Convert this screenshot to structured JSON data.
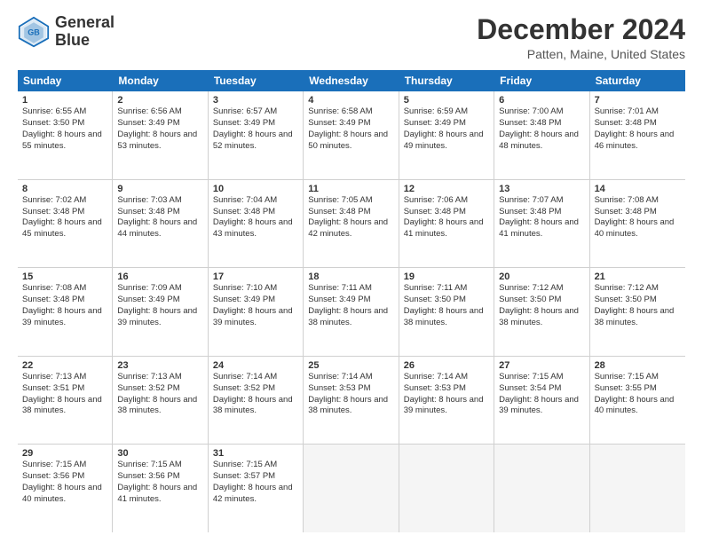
{
  "header": {
    "logo_line1": "General",
    "logo_line2": "Blue",
    "title": "December 2024",
    "subtitle": "Patten, Maine, United States"
  },
  "days": [
    "Sunday",
    "Monday",
    "Tuesday",
    "Wednesday",
    "Thursday",
    "Friday",
    "Saturday"
  ],
  "weeks": [
    [
      {
        "num": "1",
        "rise": "6:55 AM",
        "set": "3:50 PM",
        "daylight": "8 hours and 55 minutes."
      },
      {
        "num": "2",
        "rise": "6:56 AM",
        "set": "3:49 PM",
        "daylight": "8 hours and 53 minutes."
      },
      {
        "num": "3",
        "rise": "6:57 AM",
        "set": "3:49 PM",
        "daylight": "8 hours and 52 minutes."
      },
      {
        "num": "4",
        "rise": "6:58 AM",
        "set": "3:49 PM",
        "daylight": "8 hours and 50 minutes."
      },
      {
        "num": "5",
        "rise": "6:59 AM",
        "set": "3:49 PM",
        "daylight": "8 hours and 49 minutes."
      },
      {
        "num": "6",
        "rise": "7:00 AM",
        "set": "3:48 PM",
        "daylight": "8 hours and 48 minutes."
      },
      {
        "num": "7",
        "rise": "7:01 AM",
        "set": "3:48 PM",
        "daylight": "8 hours and 46 minutes."
      }
    ],
    [
      {
        "num": "8",
        "rise": "7:02 AM",
        "set": "3:48 PM",
        "daylight": "8 hours and 45 minutes."
      },
      {
        "num": "9",
        "rise": "7:03 AM",
        "set": "3:48 PM",
        "daylight": "8 hours and 44 minutes."
      },
      {
        "num": "10",
        "rise": "7:04 AM",
        "set": "3:48 PM",
        "daylight": "8 hours and 43 minutes."
      },
      {
        "num": "11",
        "rise": "7:05 AM",
        "set": "3:48 PM",
        "daylight": "8 hours and 42 minutes."
      },
      {
        "num": "12",
        "rise": "7:06 AM",
        "set": "3:48 PM",
        "daylight": "8 hours and 41 minutes."
      },
      {
        "num": "13",
        "rise": "7:07 AM",
        "set": "3:48 PM",
        "daylight": "8 hours and 41 minutes."
      },
      {
        "num": "14",
        "rise": "7:08 AM",
        "set": "3:48 PM",
        "daylight": "8 hours and 40 minutes."
      }
    ],
    [
      {
        "num": "15",
        "rise": "7:08 AM",
        "set": "3:48 PM",
        "daylight": "8 hours and 39 minutes."
      },
      {
        "num": "16",
        "rise": "7:09 AM",
        "set": "3:49 PM",
        "daylight": "8 hours and 39 minutes."
      },
      {
        "num": "17",
        "rise": "7:10 AM",
        "set": "3:49 PM",
        "daylight": "8 hours and 39 minutes."
      },
      {
        "num": "18",
        "rise": "7:11 AM",
        "set": "3:49 PM",
        "daylight": "8 hours and 38 minutes."
      },
      {
        "num": "19",
        "rise": "7:11 AM",
        "set": "3:50 PM",
        "daylight": "8 hours and 38 minutes."
      },
      {
        "num": "20",
        "rise": "7:12 AM",
        "set": "3:50 PM",
        "daylight": "8 hours and 38 minutes."
      },
      {
        "num": "21",
        "rise": "7:12 AM",
        "set": "3:50 PM",
        "daylight": "8 hours and 38 minutes."
      }
    ],
    [
      {
        "num": "22",
        "rise": "7:13 AM",
        "set": "3:51 PM",
        "daylight": "8 hours and 38 minutes."
      },
      {
        "num": "23",
        "rise": "7:13 AM",
        "set": "3:52 PM",
        "daylight": "8 hours and 38 minutes."
      },
      {
        "num": "24",
        "rise": "7:14 AM",
        "set": "3:52 PM",
        "daylight": "8 hours and 38 minutes."
      },
      {
        "num": "25",
        "rise": "7:14 AM",
        "set": "3:53 PM",
        "daylight": "8 hours and 38 minutes."
      },
      {
        "num": "26",
        "rise": "7:14 AM",
        "set": "3:53 PM",
        "daylight": "8 hours and 39 minutes."
      },
      {
        "num": "27",
        "rise": "7:15 AM",
        "set": "3:54 PM",
        "daylight": "8 hours and 39 minutes."
      },
      {
        "num": "28",
        "rise": "7:15 AM",
        "set": "3:55 PM",
        "daylight": "8 hours and 40 minutes."
      }
    ],
    [
      {
        "num": "29",
        "rise": "7:15 AM",
        "set": "3:56 PM",
        "daylight": "8 hours and 40 minutes."
      },
      {
        "num": "30",
        "rise": "7:15 AM",
        "set": "3:56 PM",
        "daylight": "8 hours and 41 minutes."
      },
      {
        "num": "31",
        "rise": "7:15 AM",
        "set": "3:57 PM",
        "daylight": "8 hours and 42 minutes."
      },
      null,
      null,
      null,
      null
    ]
  ]
}
